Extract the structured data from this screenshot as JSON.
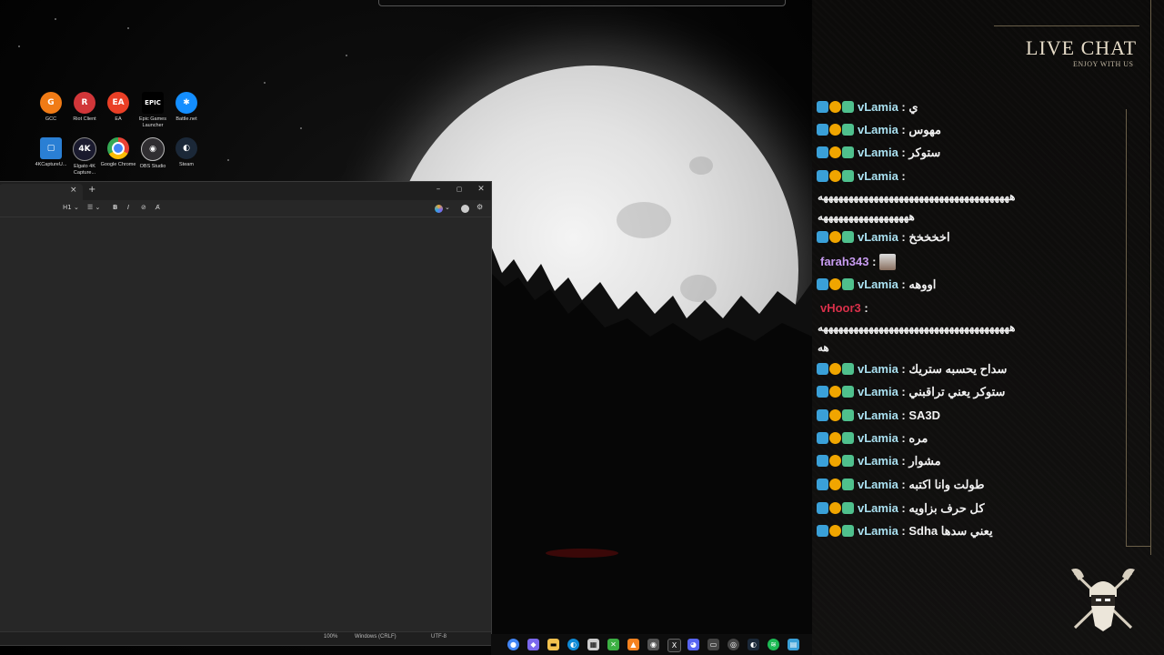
{
  "desktop": {
    "icons": [
      {
        "label": "GCC",
        "glyph": "G",
        "color": "#f07b16",
        "icon": "gcc-icon"
      },
      {
        "label": "Riot Client",
        "glyph": "R",
        "color": "#d13639",
        "icon": "riot-client-icon"
      },
      {
        "label": "EA",
        "glyph": "EA",
        "color": "#ea3f26",
        "icon": "ea-icon"
      },
      {
        "label": "Epic Games Launcher",
        "glyph": "EPIC",
        "color": "#000000",
        "icon": "epic-games-icon"
      },
      {
        "label": "Battle.net",
        "glyph": "✱",
        "color": "#148eff",
        "icon": "battlenet-icon"
      },
      {
        "label": "4KCaptureU...",
        "glyph": "▢",
        "color": "#2a7fd4",
        "icon": "4k-capture-utility-icon"
      },
      {
        "label": "Elgato 4K Capture...",
        "glyph": "4K",
        "color": "#1a1a2e",
        "icon": "elgato-icon"
      },
      {
        "label": "Google Chrome",
        "glyph": "",
        "color": "#4285f4",
        "icon": "chrome-icon"
      },
      {
        "label": "OBS Studio",
        "glyph": "◉",
        "color": "#302e31",
        "icon": "obs-icon"
      },
      {
        "label": "Steam",
        "glyph": "◐",
        "color": "#1b2838",
        "icon": "steam-icon"
      }
    ]
  },
  "editor": {
    "close_tab": "×",
    "new_tab": "+",
    "window_minimize": "–",
    "window_maximize": "▢",
    "window_close": "✕",
    "toolbar": {
      "heading": "H1",
      "list": "☰",
      "bold": "B",
      "italic": "I",
      "link": "⊘",
      "clear": "A̸"
    },
    "status": {
      "zoom": "100%",
      "line_endings": "Windows (CRLF)",
      "encoding": "UTF-8"
    }
  },
  "chat": {
    "title": "LIVE CHAT",
    "subtitle": "ENJOY WITH US",
    "messages": [
      {
        "user": "vLamia",
        "text": "ي",
        "badges": true,
        "color": "#a9e0f0"
      },
      {
        "user": "vLamia",
        "text": "مهوس",
        "badges": true,
        "color": "#a9e0f0"
      },
      {
        "user": "vLamia",
        "text": "ستوكر",
        "badges": true,
        "color": "#a9e0f0"
      },
      {
        "user": "vLamia",
        "text": "",
        "badges": true,
        "color": "#a9e0f0"
      },
      {
        "user": "vLamia",
        "text": "اخخخخخ",
        "badges": true,
        "color": "#a9e0f0"
      },
      {
        "user": "farah343",
        "text": "",
        "badges": false,
        "color": "#c79bf0"
      },
      {
        "user": "vLamia",
        "text": "اووهه",
        "badges": true,
        "color": "#a9e0f0"
      },
      {
        "user": "vHoor3",
        "text": "",
        "badges": false,
        "color": "#d9304a"
      },
      {
        "user": "vLamia",
        "text": "سداح يحسبه ستريك",
        "badges": true,
        "color": "#a9e0f0"
      },
      {
        "user": "vLamia",
        "text": "ستوكر يعني تراقبني",
        "badges": true,
        "color": "#a9e0f0"
      },
      {
        "user": "vLamia",
        "text": "SA3D",
        "badges": true,
        "color": "#a9e0f0"
      },
      {
        "user": "vLamia",
        "text": "مره",
        "badges": true,
        "color": "#a9e0f0"
      },
      {
        "user": "vLamia",
        "text": "مشوار",
        "badges": true,
        "color": "#a9e0f0"
      },
      {
        "user": "vLamia",
        "text": "طولت وانا اكتبه",
        "badges": true,
        "color": "#a9e0f0"
      },
      {
        "user": "vLamia",
        "text": "كل حرف بزاويه",
        "badges": true,
        "color": "#a9e0f0"
      },
      {
        "user": "vLamia",
        "text": "Sdha يعني سدها",
        "badges": true,
        "color": "#a9e0f0"
      }
    ],
    "long1a": "ههههههههههههههههههههههههههههههههههههههه",
    "long1b": "ههههههههههههههههههه",
    "long2a": "ههههههههههههههههههههههههههههههههههههههه",
    "long2b": "هه"
  },
  "taskbar": {
    "icons": [
      {
        "name": "chrome-taskbar-icon",
        "glyph": "●",
        "color": "#4285f4"
      },
      {
        "name": "copilot-taskbar-icon",
        "glyph": "◆",
        "color": "#7b68ee"
      },
      {
        "name": "file-explorer-taskbar-icon",
        "glyph": "▬",
        "color": "#f2c14e"
      },
      {
        "name": "edge-taskbar-icon",
        "glyph": "◐",
        "color": "#0f8ad6"
      },
      {
        "name": "store-taskbar-icon",
        "glyph": "▦",
        "color": "#cccccc"
      },
      {
        "name": "xbox-taskbar-icon",
        "glyph": "✕",
        "color": "#3cb043"
      },
      {
        "name": "vlc-taskbar-icon",
        "glyph": "▲",
        "color": "#f58220"
      },
      {
        "name": "capture-taskbar-icon",
        "glyph": "◉",
        "color": "#555555"
      },
      {
        "name": "x-taskbar-icon",
        "glyph": "X",
        "color": "#222222"
      },
      {
        "name": "discord-taskbar-icon",
        "glyph": "◕",
        "color": "#5865f2"
      },
      {
        "name": "game-taskbar-icon",
        "glyph": "▭",
        "color": "#444444"
      },
      {
        "name": "obs-taskbar-icon",
        "glyph": "◎",
        "color": "#444444"
      },
      {
        "name": "steam-taskbar-icon",
        "glyph": "◐",
        "color": "#1b2838"
      },
      {
        "name": "spotify-taskbar-icon",
        "glyph": "≋",
        "color": "#1db954"
      },
      {
        "name": "notepad-taskbar-icon",
        "glyph": "▤",
        "color": "#3aa0d8"
      }
    ]
  }
}
